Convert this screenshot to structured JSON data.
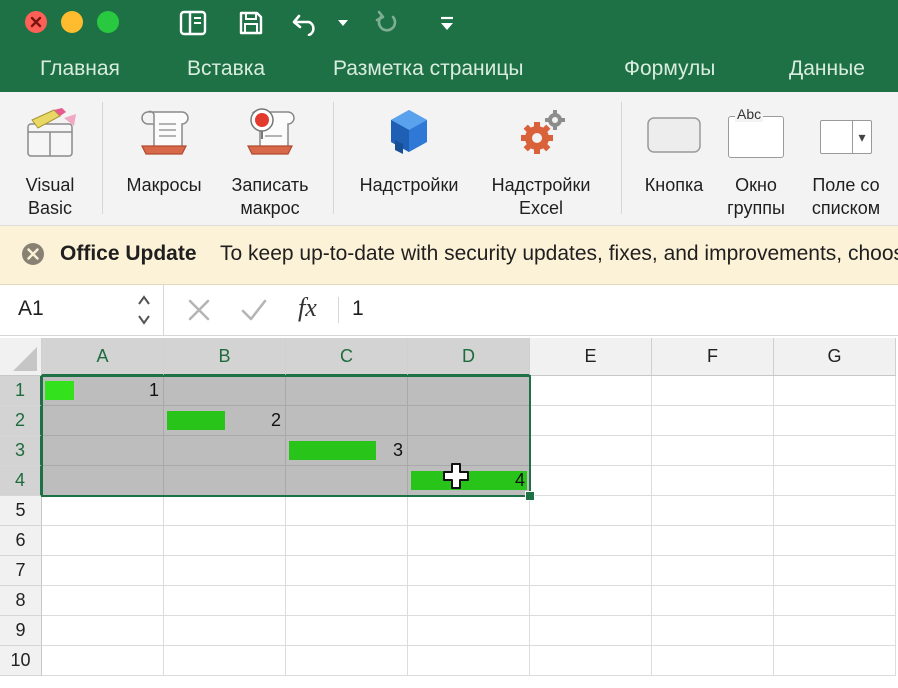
{
  "colors": {
    "accent": "#1e7145",
    "selection_fill": "#bdbdbd",
    "databar": "#29c41a",
    "message_bg": "#fcf2d8"
  },
  "window_controls": [
    "close",
    "minimize",
    "zoom"
  ],
  "quick_access": [
    "sidebar-icon",
    "save-icon",
    "undo-icon",
    "redo-icon",
    "customize-icon"
  ],
  "tabs": [
    {
      "label": "Главная"
    },
    {
      "label": "Вставка"
    },
    {
      "label": "Разметка страницы"
    },
    {
      "label": "Формулы"
    },
    {
      "label": "Данные"
    }
  ],
  "ribbon": [
    {
      "label": "Visual\nBasic",
      "icon": "visual-basic-icon"
    },
    {
      "label": "Макросы",
      "icon": "macros-icon"
    },
    {
      "label": "Записать\nмакрос",
      "icon": "record-macro-icon"
    },
    {
      "label": "Надстройки",
      "icon": "addins-icon"
    },
    {
      "label": "Надстройки\nExcel",
      "icon": "excel-addins-icon"
    },
    {
      "label": "Кнопка",
      "icon": "button-control-icon"
    },
    {
      "label": "Окно\nгруппы",
      "icon": "group-box-icon",
      "glyph": "Abc"
    },
    {
      "label": "Поле со\nсписком",
      "icon": "combo-box-icon",
      "glyph": "▾"
    }
  ],
  "message_bar": {
    "title": "Office Update",
    "text": "To keep up-to-date with security updates, fixes, and improvements, choose Check for Updates."
  },
  "formula_bar": {
    "name_box": "A1",
    "fx": "fx",
    "value": "1"
  },
  "grid": {
    "columns": [
      "A",
      "B",
      "C",
      "D",
      "E",
      "F",
      "G"
    ],
    "rows": [
      "1",
      "2",
      "3",
      "4",
      "5",
      "6",
      "7",
      "8",
      "9",
      "10"
    ],
    "selection": "A1:D4",
    "databars": [
      {
        "row": "1",
        "col": "A",
        "value": 1
      },
      {
        "row": "2",
        "col": "B",
        "value": 2
      },
      {
        "row": "3",
        "col": "C",
        "value": 3
      },
      {
        "row": "4",
        "col": "D",
        "value": 4
      }
    ]
  }
}
